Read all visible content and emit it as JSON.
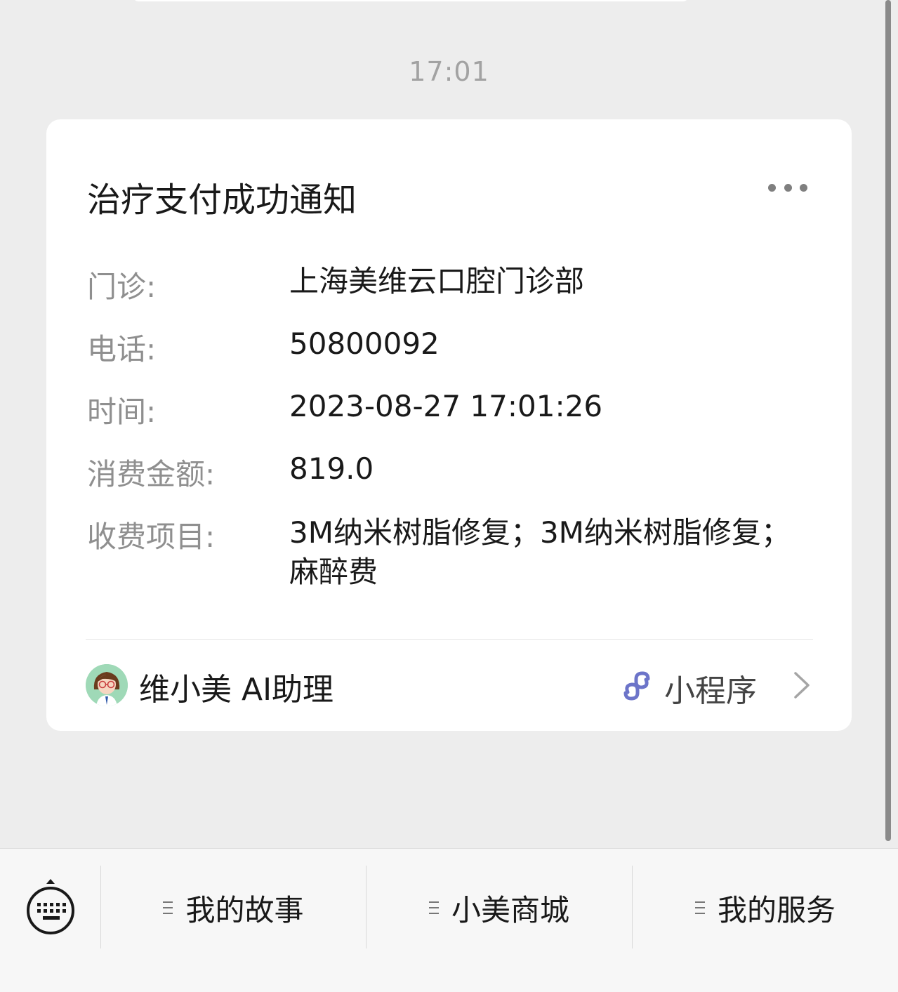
{
  "chat": {
    "timestamp": "17:01"
  },
  "card": {
    "title": "治疗支付成功通知",
    "fields": [
      {
        "label": "门诊:",
        "value": "上海美维云口腔门诊部"
      },
      {
        "label": "电话:",
        "value": "50800092"
      },
      {
        "label": "时间:",
        "value": "2023-08-27 17:01:26"
      },
      {
        "label": "消费金额:",
        "value": "819.0"
      },
      {
        "label": "收费项目:",
        "value": "3M纳米树脂修复；3M纳米树脂修复；麻醉费"
      }
    ],
    "footer": {
      "account_name": "维小美 AI助理",
      "mini_program_label": "小程序"
    }
  },
  "bottom_menu": {
    "items": [
      {
        "label": "我的故事"
      },
      {
        "label": "小美商城"
      },
      {
        "label": "我的服务"
      }
    ]
  },
  "colors": {
    "background": "#ededed",
    "card": "#ffffff",
    "label_gray": "#8f8f8f",
    "mini_program_icon": "#6c74c9",
    "avatar_bg": "#9fd9b7"
  },
  "icons": {
    "more": "more-dots-icon",
    "mini_program": "mini-program-link-icon",
    "chevron": "chevron-right-icon",
    "keyboard": "keyboard-icon",
    "menu": "menu-lines-icon"
  }
}
